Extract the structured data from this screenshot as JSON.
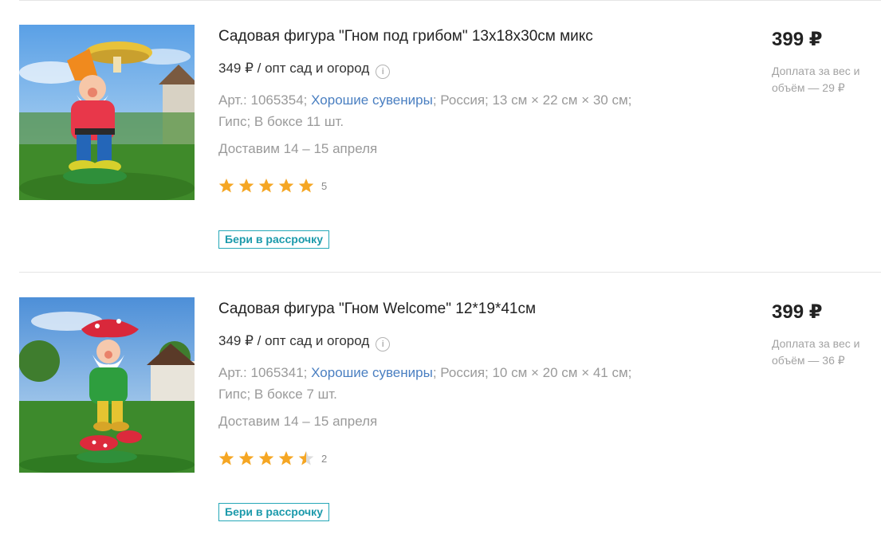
{
  "products": [
    {
      "title": "Садовая фигура \"Гном под грибом\" 13х18х30см микс",
      "wholesale_text": "349 ₽ / опт сад и огород",
      "article_prefix": "Арт.: 1065354;",
      "brand": "Хорошие сувениры",
      "details_rest": "; Россия; 13 см × 22 см × 30 см; Гипс; В боксе 11 шт.",
      "delivery": "Доставим 14 – 15 апреля",
      "rating": 5,
      "rating_count": "5",
      "installment_label": "Бери в рассрочку",
      "price": "399 ₽",
      "surcharge": "Доплата за вес и объём — 29 ₽",
      "image_icon": "gnome-with-mushroom-figurine"
    },
    {
      "title": "Садовая фигура \"Гном Welcome\" 12*19*41см",
      "wholesale_text": "349 ₽ / опт сад и огород",
      "article_prefix": "Арт.: 1065341;",
      "brand": "Хорошие сувениры",
      "details_rest": "; Россия; 10 см × 20 см × 41 см; Гипс; В боксе 7 шт.",
      "delivery": "Доставим 14 – 15 апреля",
      "rating": 4.5,
      "rating_count": "2",
      "installment_label": "Бери в рассрочку",
      "price": "399 ₽",
      "surcharge": "Доплата за вес и объём — 36 ₽",
      "image_icon": "gnome-welcome-figurine"
    }
  ],
  "info_icon_glyph": "i",
  "colors": {
    "star": "#f5a623",
    "star_empty": "#dcdcdc",
    "link": "#4a7fc1",
    "installment": "#1c9aab"
  }
}
